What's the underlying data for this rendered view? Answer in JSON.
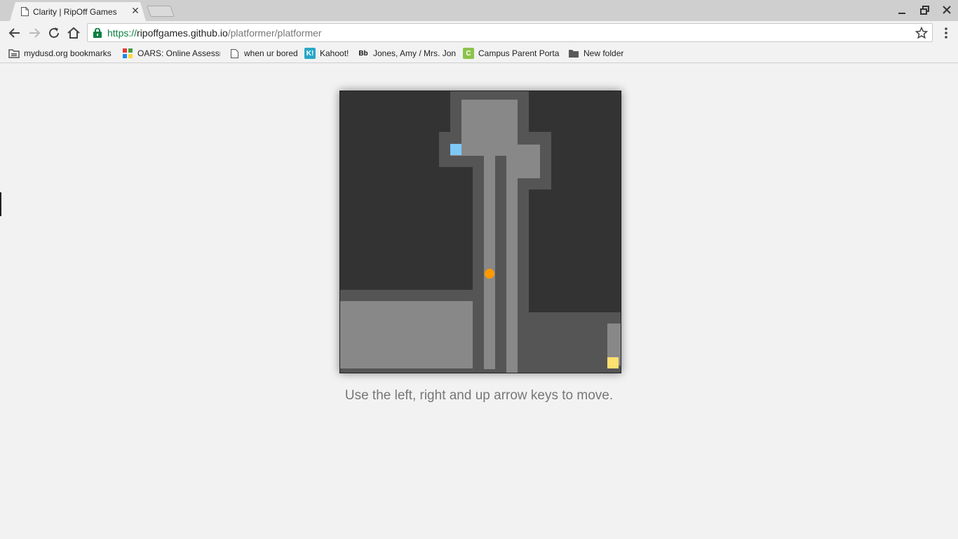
{
  "tab": {
    "title": "Clarity | RipOff Games"
  },
  "address": {
    "scheme": "https://",
    "host": "ripoffgames.github.io",
    "path": "/platformer/platformer"
  },
  "bookmarks": [
    {
      "label": "mydusd.org bookmarks",
      "icon": "folder-bookmarks-icon"
    },
    {
      "label": "OARS: Online Assessm",
      "icon": "oars-icon"
    },
    {
      "label": "when ur bored",
      "icon": "page-icon"
    },
    {
      "label": "Kahoot!",
      "icon": "kahoot-icon"
    },
    {
      "label": "Jones, Amy / Mrs. Jon",
      "icon": "blackboard-icon"
    },
    {
      "label": "Campus Parent Porta",
      "icon": "campus-icon"
    },
    {
      "label": "New folder",
      "icon": "folder-icon"
    }
  ],
  "game": {
    "colors": {
      "wall": "#333333",
      "dark_floor": "#555555",
      "light_floor": "#888888",
      "player": "#ff9900",
      "spawn": "#7ec8f7",
      "goal": "#ffe070"
    },
    "player_icon": "player-dot",
    "spawn_icon": "spawn-block",
    "goal_icon": "goal-block"
  },
  "instructions": "Use the left, right and up arrow keys to move."
}
